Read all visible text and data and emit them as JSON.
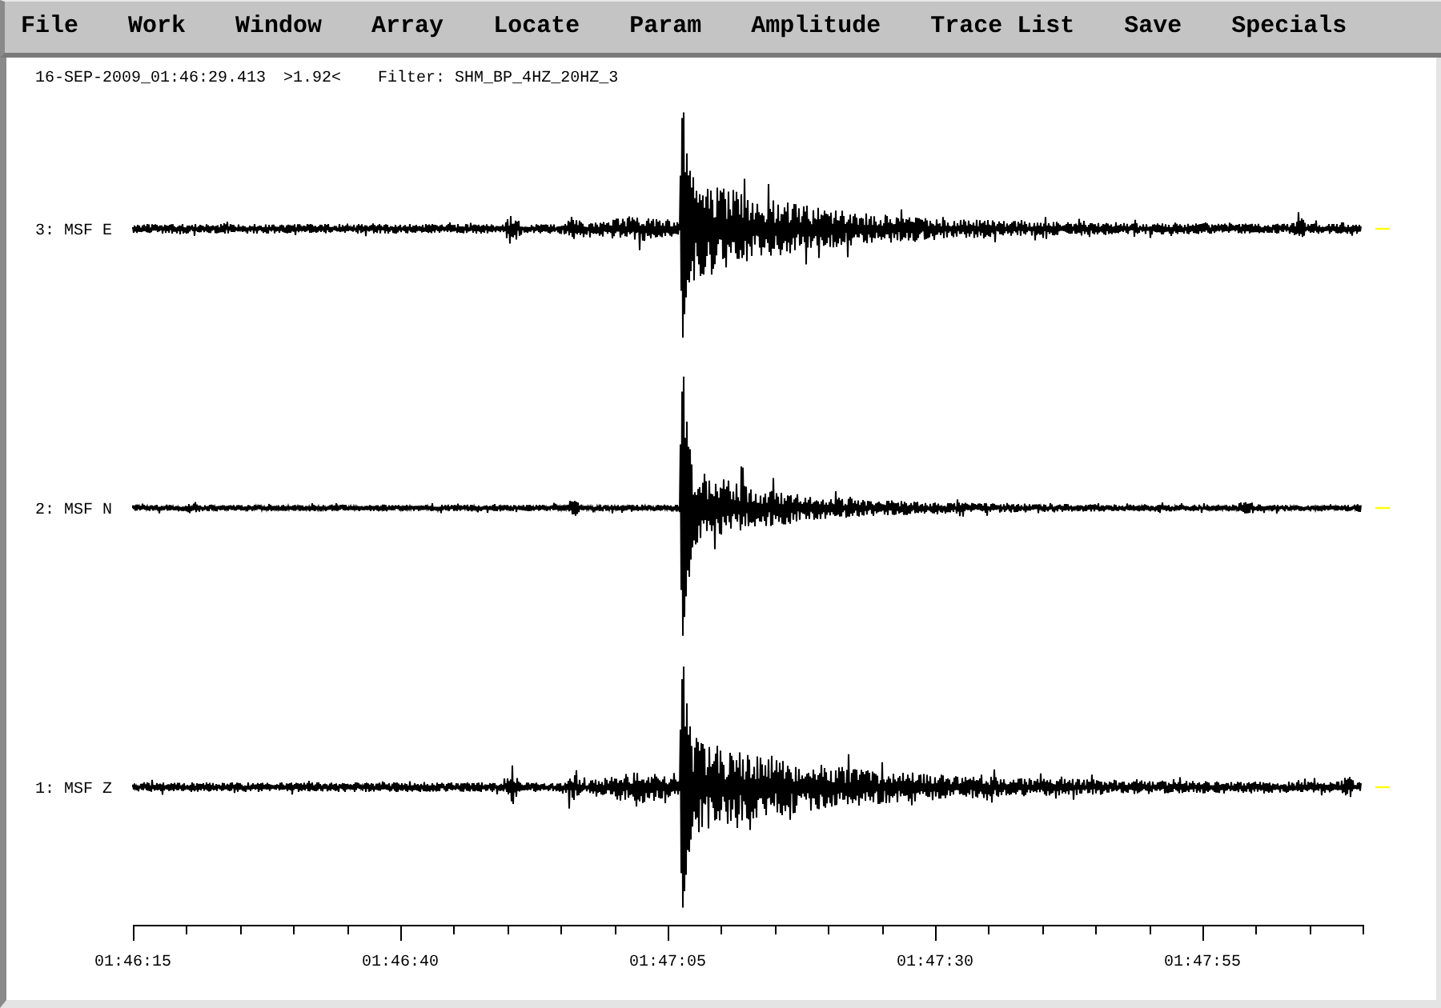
{
  "menu_bar": [
    "File",
    "Work",
    "Window",
    "Array",
    "Locate",
    "Param",
    "Amplitude",
    "Trace List",
    "Save",
    "Specials"
  ],
  "header": {
    "timestamp": "16-SEP-2009_01:46:29.413",
    "readout": ">1.92<",
    "filter": "Filter: SHM_BP_4HZ_20HZ_3"
  },
  "traces": [
    {
      "label": "3: MSF E"
    },
    {
      "label": "2: MSF N"
    },
    {
      "label": "1: MSF Z"
    }
  ],
  "time_axis": {
    "tick_labels": [
      "01:46:15",
      "01:46:40",
      "01:47:05",
      "01:47:30",
      "01:47:55"
    ]
  }
}
